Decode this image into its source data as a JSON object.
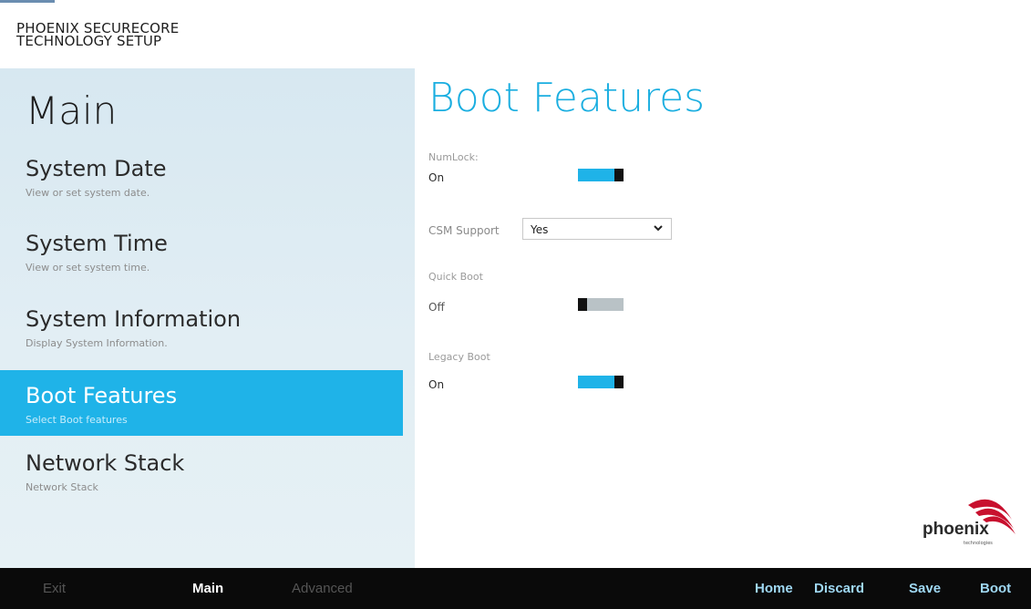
{
  "brand": {
    "line1": "PHOENIX SECURECORE",
    "line2": "TECHNOLOGY SETUP"
  },
  "sidebar": {
    "title": "Main",
    "items": [
      {
        "label": "System Date",
        "desc": "View or set system date."
      },
      {
        "label": "System Time",
        "desc": "View or set system time."
      },
      {
        "label": "System Information",
        "desc": "Display System Information."
      },
      {
        "label": "Boot Features",
        "desc": "Select Boot features",
        "active": true
      },
      {
        "label": "Network Stack",
        "desc": "Network Stack"
      }
    ]
  },
  "main": {
    "title": "Boot Features",
    "numlock": {
      "label": "NumLock:",
      "value": "On",
      "state": "on"
    },
    "csm": {
      "label": "CSM Support",
      "value": "Yes"
    },
    "quick_boot": {
      "label": "Quick Boot",
      "value": "Off",
      "state": "off"
    },
    "legacy_boot": {
      "label": "Legacy Boot",
      "value": "On",
      "state": "on"
    }
  },
  "logo": {
    "text": "phoenix",
    "sub": "technologies"
  },
  "bottom_bar": {
    "exit": "Exit",
    "main": "Main",
    "advanced": "Advanced",
    "home": "Home",
    "discard": "Discard",
    "save": "Save",
    "boot": "Boot"
  },
  "colors": {
    "accent": "#1fb3e8",
    "title": "#1aaee0",
    "sidebar_bg": "#dfecf3",
    "bottom_bar_bg": "#0a0a0a",
    "action_text": "#9fd8f3",
    "logo_swoosh": "#c8102e"
  }
}
